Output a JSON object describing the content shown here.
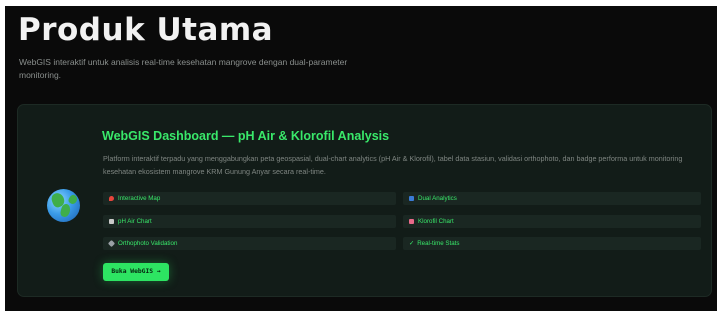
{
  "header": {
    "title": "Produk Utama",
    "subtitle": "WebGIS interaktif untuk analisis real-time kesehatan mangrove dengan dual-parameter monitoring."
  },
  "product_card": {
    "icon": "globe-icon",
    "title": "WebGIS Dashboard — pH Air & Klorofil Analysis",
    "description": "Platform interaktif terpadu yang menggabungkan peta geospasial, dual-chart analytics (pH Air & Klorofil), tabel data stasiun, validasi orthophoto, dan badge performa untuk monitoring kesehatan ekosistem mangrove KRM Gunung Anyar secara real-time.",
    "features": [
      {
        "label": "Interactive Map",
        "icon": "pin-icon",
        "color": "#e8453c"
      },
      {
        "label": "Dual Analytics",
        "icon": "chart-bar-icon",
        "color": "#3a7bd5"
      },
      {
        "label": "pH Air Chart",
        "icon": "chart-up-icon",
        "color": "#c9c9c9"
      },
      {
        "label": "Klorofil Chart",
        "icon": "chart-down-icon",
        "color": "#e86a8a"
      },
      {
        "label": "Orthophoto Validation",
        "icon": "satellite-icon",
        "color": "#9aa0a6"
      },
      {
        "label": "Real-time Stats",
        "icon": "check-icon",
        "color": "#39e86a"
      }
    ],
    "cta_label": "Buka WebGIS →"
  },
  "colors": {
    "page_background": "#0a0a0a",
    "card_background": "#121c18",
    "accent_green": "#39e86a",
    "button_green": "#2de462"
  }
}
